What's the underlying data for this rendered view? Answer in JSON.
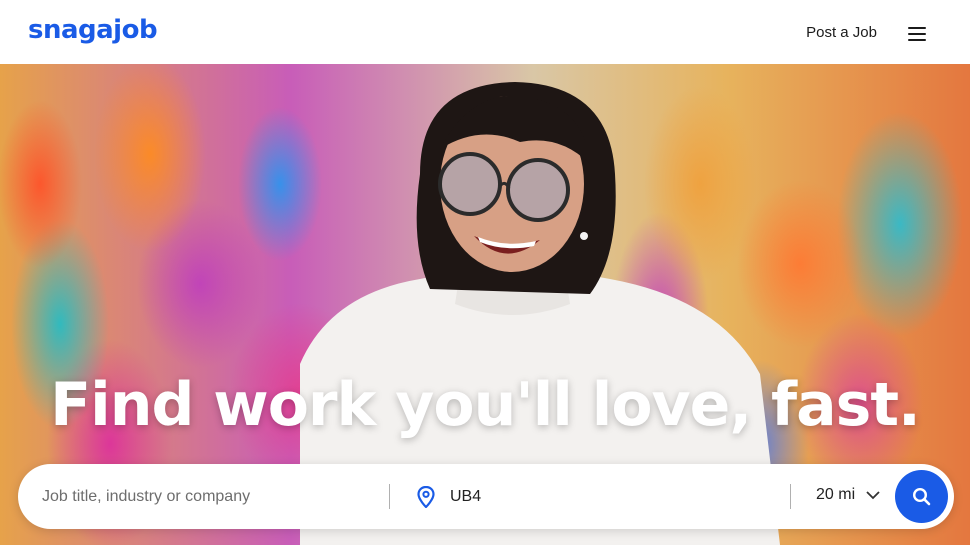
{
  "header": {
    "logo_text": "snagajob",
    "post_job_label": "Post a Job",
    "menu_icon": "hamburger-menu-icon"
  },
  "hero": {
    "headline": "Find work you'll love, fast."
  },
  "search": {
    "job_placeholder": "Job title, industry or company",
    "location_value": "UB4",
    "location_icon": "map-pin-icon",
    "radius_value": "20 mi",
    "radius_icon": "chevron-down-icon",
    "submit_icon": "search-icon"
  },
  "colors": {
    "brand": "#1a5be6",
    "text": "#1b1b1b"
  }
}
